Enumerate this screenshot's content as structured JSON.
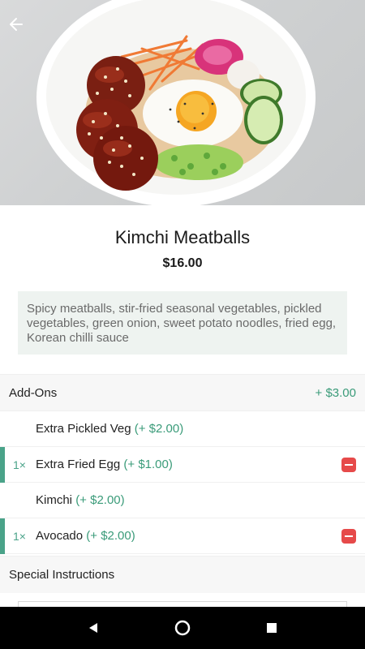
{
  "item": {
    "title": "Kimchi Meatballs",
    "price": "$16.00",
    "description": "Spicy meatballs, stir-fried seasonal vegetables, pickled vegetables, green onion, sweet potato noodles, fried egg, Korean chilli sauce"
  },
  "addons": {
    "label": "Add-Ons",
    "total": "+ $3.00",
    "items": [
      {
        "qty": "",
        "name": "Extra Pickled Veg",
        "price": "(+ $2.00)",
        "selected": false
      },
      {
        "qty": "1×",
        "name": "Extra Fried Egg",
        "price": "(+ $1.00)",
        "selected": true
      },
      {
        "qty": "",
        "name": "Kimchi",
        "price": "(+ $2.00)",
        "selected": false
      },
      {
        "qty": "1×",
        "name": "Avocado",
        "price": "(+ $2.00)",
        "selected": true
      }
    ]
  },
  "special": {
    "label": "Special Instructions",
    "value": ""
  },
  "icons": {
    "back": "arrow-left-icon",
    "remove": "minus-icon",
    "nav_back": "triangle-back-icon",
    "nav_home": "circle-home-icon",
    "nav_recents": "square-recents-icon"
  },
  "colors": {
    "accent": "#3a9b79",
    "remove": "#e64a4a",
    "description_bg": "#eef3f0"
  }
}
